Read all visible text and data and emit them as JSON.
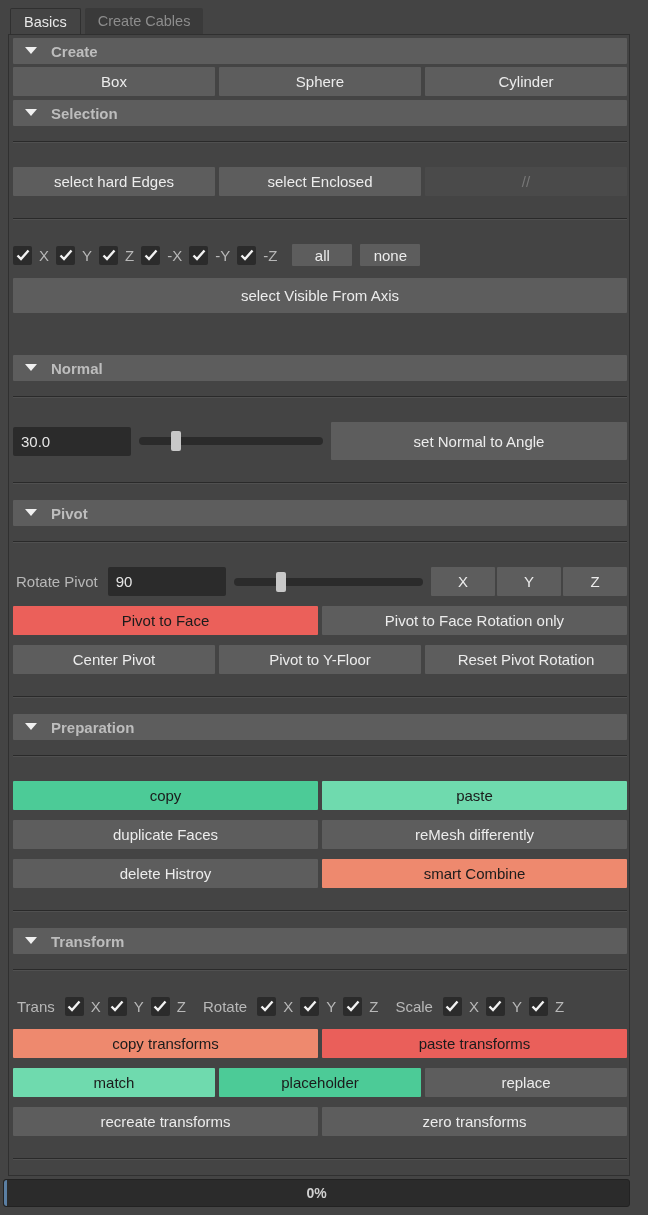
{
  "tabs": [
    {
      "label": "Basics",
      "selected": true
    },
    {
      "label": "Create Cables",
      "selected": false
    }
  ],
  "sections": [
    {
      "title": "Create",
      "expanded": true,
      "rows": [
        {
          "kind": "buttons",
          "items": [
            {
              "kind": "button",
              "label": "Box"
            },
            {
              "kind": "button",
              "label": "Sphere"
            },
            {
              "kind": "button",
              "label": "Cylinder"
            }
          ]
        }
      ]
    },
    {
      "title": "Selection",
      "expanded": true,
      "rows": [
        {
          "kind": "divider"
        },
        {
          "kind": "buttons",
          "items": [
            {
              "kind": "button",
              "label": "select hard Edges"
            },
            {
              "kind": "button",
              "label": "select Enclosed"
            },
            {
              "kind": "button",
              "label": "//",
              "disabled": true
            }
          ]
        },
        {
          "kind": "divider"
        },
        {
          "kind": "checks",
          "items": [
            {
              "kind": "checkbox",
              "label": "X",
              "checked": true
            },
            {
              "kind": "checkbox",
              "label": "Y",
              "checked": true
            },
            {
              "kind": "checkbox",
              "label": "Z",
              "checked": true
            },
            {
              "kind": "checkbox",
              "label": "-X",
              "checked": true
            },
            {
              "kind": "checkbox",
              "label": "-Y",
              "checked": true
            },
            {
              "kind": "checkbox",
              "label": "-Z",
              "checked": true
            },
            {
              "kind": "button",
              "label": "all"
            },
            {
              "kind": "button",
              "label": "none"
            }
          ]
        },
        {
          "kind": "buttons",
          "items": [
            {
              "kind": "button",
              "label": "select Visible From Axis"
            }
          ]
        }
      ]
    },
    {
      "title": "Normal",
      "expanded": true,
      "rows": [
        {
          "kind": "divider"
        },
        {
          "kind": "slider",
          "items": [
            {
              "kind": "field",
              "value": "30.0"
            },
            {
              "kind": "slider",
              "level": 0.2
            },
            {
              "kind": "button",
              "label": "set Normal to Angle"
            }
          ]
        },
        {
          "kind": "divider"
        }
      ]
    },
    {
      "title": "Pivot",
      "expanded": true,
      "rows": [
        {
          "kind": "divider"
        },
        {
          "kind": "slider",
          "items": [
            {
              "kind": "label",
              "text": "Rotate Pivot"
            },
            {
              "kind": "field",
              "value": "90"
            },
            {
              "kind": "slider",
              "level": 0.25
            },
            {
              "kind": "button",
              "label": "X"
            },
            {
              "kind": "button",
              "label": "Y"
            },
            {
              "kind": "button",
              "label": "Z"
            }
          ]
        },
        {
          "kind": "buttons",
          "items": [
            {
              "kind": "button",
              "label": "Pivot to Face",
              "color": "#eb605a"
            },
            {
              "kind": "button",
              "label": "Pivot to Face Rotation only"
            }
          ]
        },
        {
          "kind": "buttons",
          "items": [
            {
              "kind": "button",
              "label": "Center Pivot"
            },
            {
              "kind": "button",
              "label": "Pivot to Y-Floor"
            },
            {
              "kind": "button",
              "label": "Reset Pivot Rotation"
            }
          ]
        },
        {
          "kind": "divider"
        }
      ]
    },
    {
      "title": "Preparation",
      "expanded": true,
      "rows": [
        {
          "kind": "divider"
        },
        {
          "kind": "buttons",
          "items": [
            {
              "kind": "button",
              "label": "copy",
              "color": "#4ccb97"
            },
            {
              "kind": "button",
              "label": "paste",
              "color": "#6fdaae"
            }
          ]
        },
        {
          "kind": "buttons",
          "items": [
            {
              "kind": "button",
              "label": "duplicate Faces"
            },
            {
              "kind": "button",
              "label": "reMesh differently"
            }
          ]
        },
        {
          "kind": "buttons",
          "items": [
            {
              "kind": "button",
              "label": "delete Histroy"
            },
            {
              "kind": "button",
              "label": "smart Combine",
              "color": "#ee896e"
            }
          ]
        },
        {
          "kind": "divider"
        }
      ]
    },
    {
      "title": "Transform",
      "expanded": true,
      "rows": [
        {
          "kind": "divider"
        },
        {
          "kind": "checks",
          "items": [
            {
              "kind": "label",
              "text": "Trans"
            },
            {
              "kind": "checkbox",
              "label": "X",
              "checked": true
            },
            {
              "kind": "checkbox",
              "label": "Y",
              "checked": true
            },
            {
              "kind": "checkbox",
              "label": "Z",
              "checked": true
            },
            {
              "kind": "label",
              "text": "Rotate"
            },
            {
              "kind": "checkbox",
              "label": "X",
              "checked": true
            },
            {
              "kind": "checkbox",
              "label": "Y",
              "checked": true
            },
            {
              "kind": "checkbox",
              "label": "Z",
              "checked": true
            },
            {
              "kind": "label",
              "text": "Scale"
            },
            {
              "kind": "checkbox",
              "label": "X",
              "checked": true
            },
            {
              "kind": "checkbox",
              "label": "Y",
              "checked": true
            },
            {
              "kind": "checkbox",
              "label": "Z",
              "checked": true
            }
          ]
        },
        {
          "kind": "buttons",
          "items": [
            {
              "kind": "button",
              "label": "copy transforms",
              "color": "#ee896e"
            },
            {
              "kind": "button",
              "label": "paste transforms",
              "color": "#ea5f5a"
            }
          ]
        },
        {
          "kind": "buttons",
          "items": [
            {
              "kind": "button",
              "label": "match",
              "color": "#6fdaae"
            },
            {
              "kind": "button",
              "label": "placeholder",
              "color": "#4ccb97"
            },
            {
              "kind": "button",
              "label": "replace"
            }
          ]
        },
        {
          "kind": "buttons",
          "items": [
            {
              "kind": "button",
              "label": "recreate transforms"
            },
            {
              "kind": "button",
              "label": "zero transforms"
            }
          ]
        },
        {
          "kind": "divider"
        }
      ]
    }
  ],
  "progress": {
    "label": "0%",
    "level": 0
  }
}
